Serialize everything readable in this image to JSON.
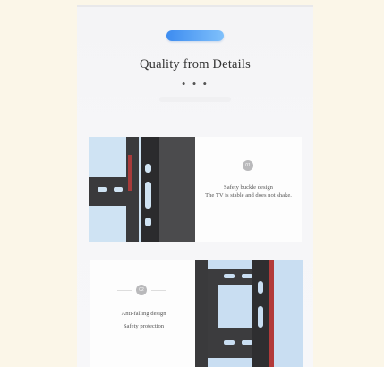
{
  "header": {
    "title": "Quality from Details",
    "dots": "• • •"
  },
  "cards": [
    {
      "badge": "01",
      "line1": "Safety buckle design",
      "line2": "The TV is stable and does not shake."
    },
    {
      "badge": "02",
      "line1": "Anti-falling design",
      "line2": "Safety protection"
    }
  ],
  "colors": {
    "accent_pill": "#4a96f2",
    "background": "#fbf6e8",
    "panel": "#f5f5f7",
    "bracket_metal": "#2f2f31",
    "red_accent": "#b23a3a"
  }
}
